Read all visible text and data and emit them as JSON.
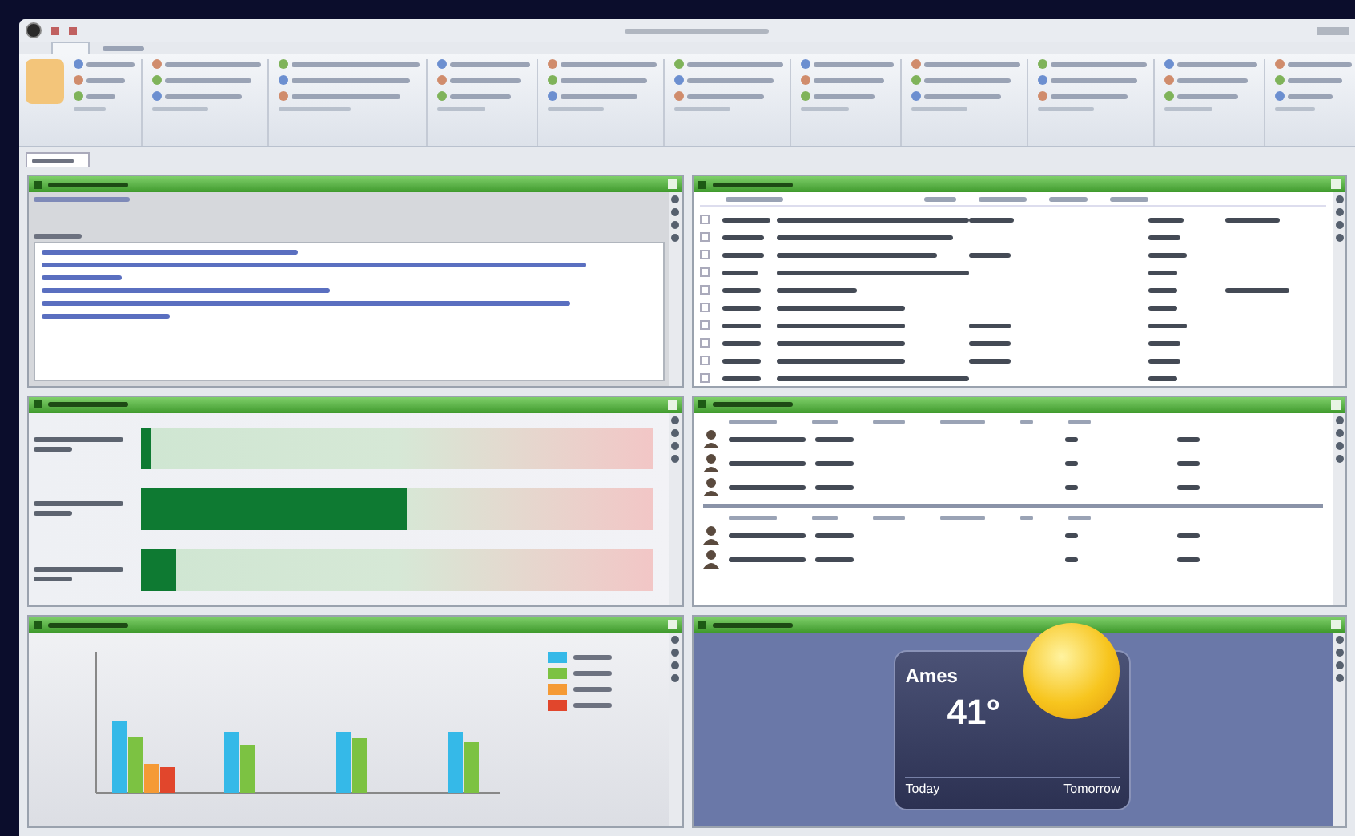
{
  "panels": [
    {
      "kind": "notes"
    },
    {
      "kind": "tasks",
      "rows": [
        {
          "checked": false
        },
        {
          "checked": false
        },
        {
          "checked": false
        },
        {
          "checked": false
        },
        {
          "checked": false
        },
        {
          "checked": false
        },
        {
          "checked": false
        },
        {
          "checked": false
        },
        {
          "checked": false
        },
        {
          "checked": false
        }
      ]
    },
    {
      "kind": "gauge",
      "bars": [
        {
          "level": 0.02
        },
        {
          "level": 0.52
        },
        {
          "level": 0.07
        }
      ]
    },
    {
      "kind": "contacts"
    },
    {
      "kind": "chart"
    },
    {
      "kind": "weather",
      "city": "Ames",
      "temperature": "41°",
      "forecast": [
        "Today",
        "Tomorrow"
      ]
    }
  ]
}
